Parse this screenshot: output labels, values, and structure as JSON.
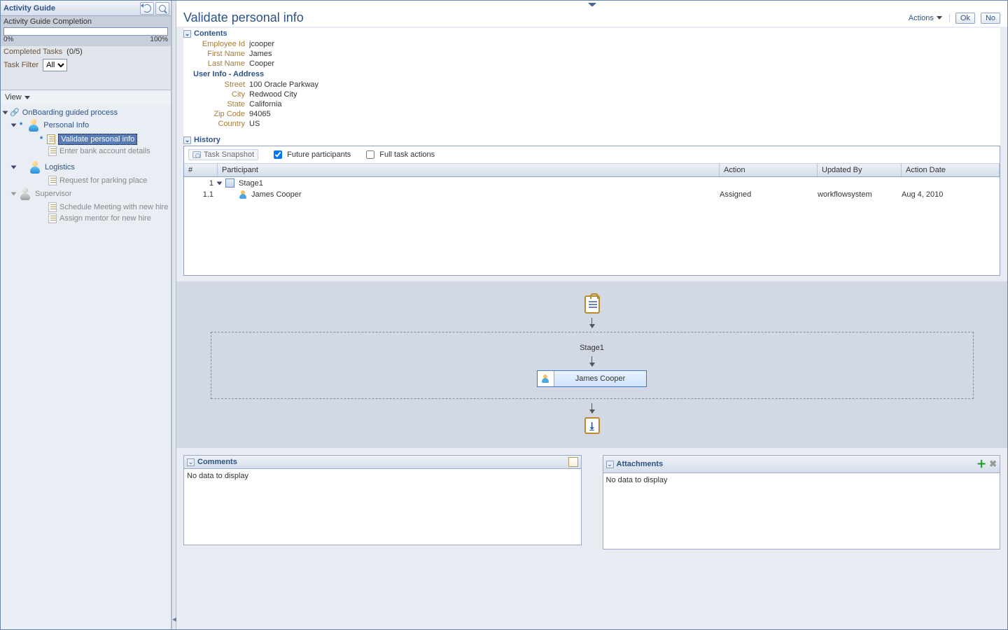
{
  "sidebar": {
    "title": "Activity Guide",
    "completion_label": "Activity Guide Completion",
    "scale_low": "0%",
    "scale_high": "100%",
    "completed_label": "Completed Tasks",
    "completed_value": "(0/5)",
    "task_filter_label": "Task Filter",
    "task_filter_value": "All",
    "view_label": "View",
    "tree": {
      "root": "OnBoarding guided process",
      "group1": "Personal Info",
      "g1_item1": "Validate personal info",
      "g1_item2": "Enter bank account details",
      "group2": "Logistics",
      "g2_item1": "Request for parking place",
      "group3": "Supervisor",
      "g3_item1": "Schedule Meeting with new hire",
      "g3_item2": "Assign mentor for new hire"
    }
  },
  "header": {
    "title": "Validate personal info",
    "actions": "Actions",
    "ok": "Ok",
    "no": "No"
  },
  "contents": {
    "heading": "Contents",
    "rows": {
      "emp_id_l": "Employee Id",
      "emp_id_v": "jcooper",
      "first_l": "First Name",
      "first_v": "James",
      "last_l": "Last Name",
      "last_v": "Cooper"
    },
    "addr_heading": "User Info - Address",
    "addr": {
      "street_l": "Street",
      "street_v": "100 Oracle Parkway",
      "city_l": "City",
      "city_v": "Redwood City",
      "state_l": "State",
      "state_v": "California",
      "zip_l": "Zip Code",
      "zip_v": "94065",
      "country_l": "Country",
      "country_v": "US"
    }
  },
  "history": {
    "heading": "History",
    "snapshot": "Task Snapshot",
    "future_label": "Future participants",
    "full_label": "Full task actions",
    "cols": {
      "num": "#",
      "part": "Participant",
      "act": "Action",
      "upd": "Updated By",
      "date": "Action Date"
    },
    "rows": [
      {
        "num": "1",
        "name": "Stage1",
        "type": "stage"
      },
      {
        "num": "1.1",
        "name": "James Cooper",
        "type": "person",
        "action": "Assigned",
        "updated_by": "workflowsystem",
        "date": "Aug 4, 2010"
      }
    ]
  },
  "diagram": {
    "stage_label": "Stage1",
    "participant": "James Cooper"
  },
  "comments": {
    "title": "Comments",
    "empty": "No data to display"
  },
  "attachments": {
    "title": "Attachments",
    "empty": "No data to display"
  }
}
